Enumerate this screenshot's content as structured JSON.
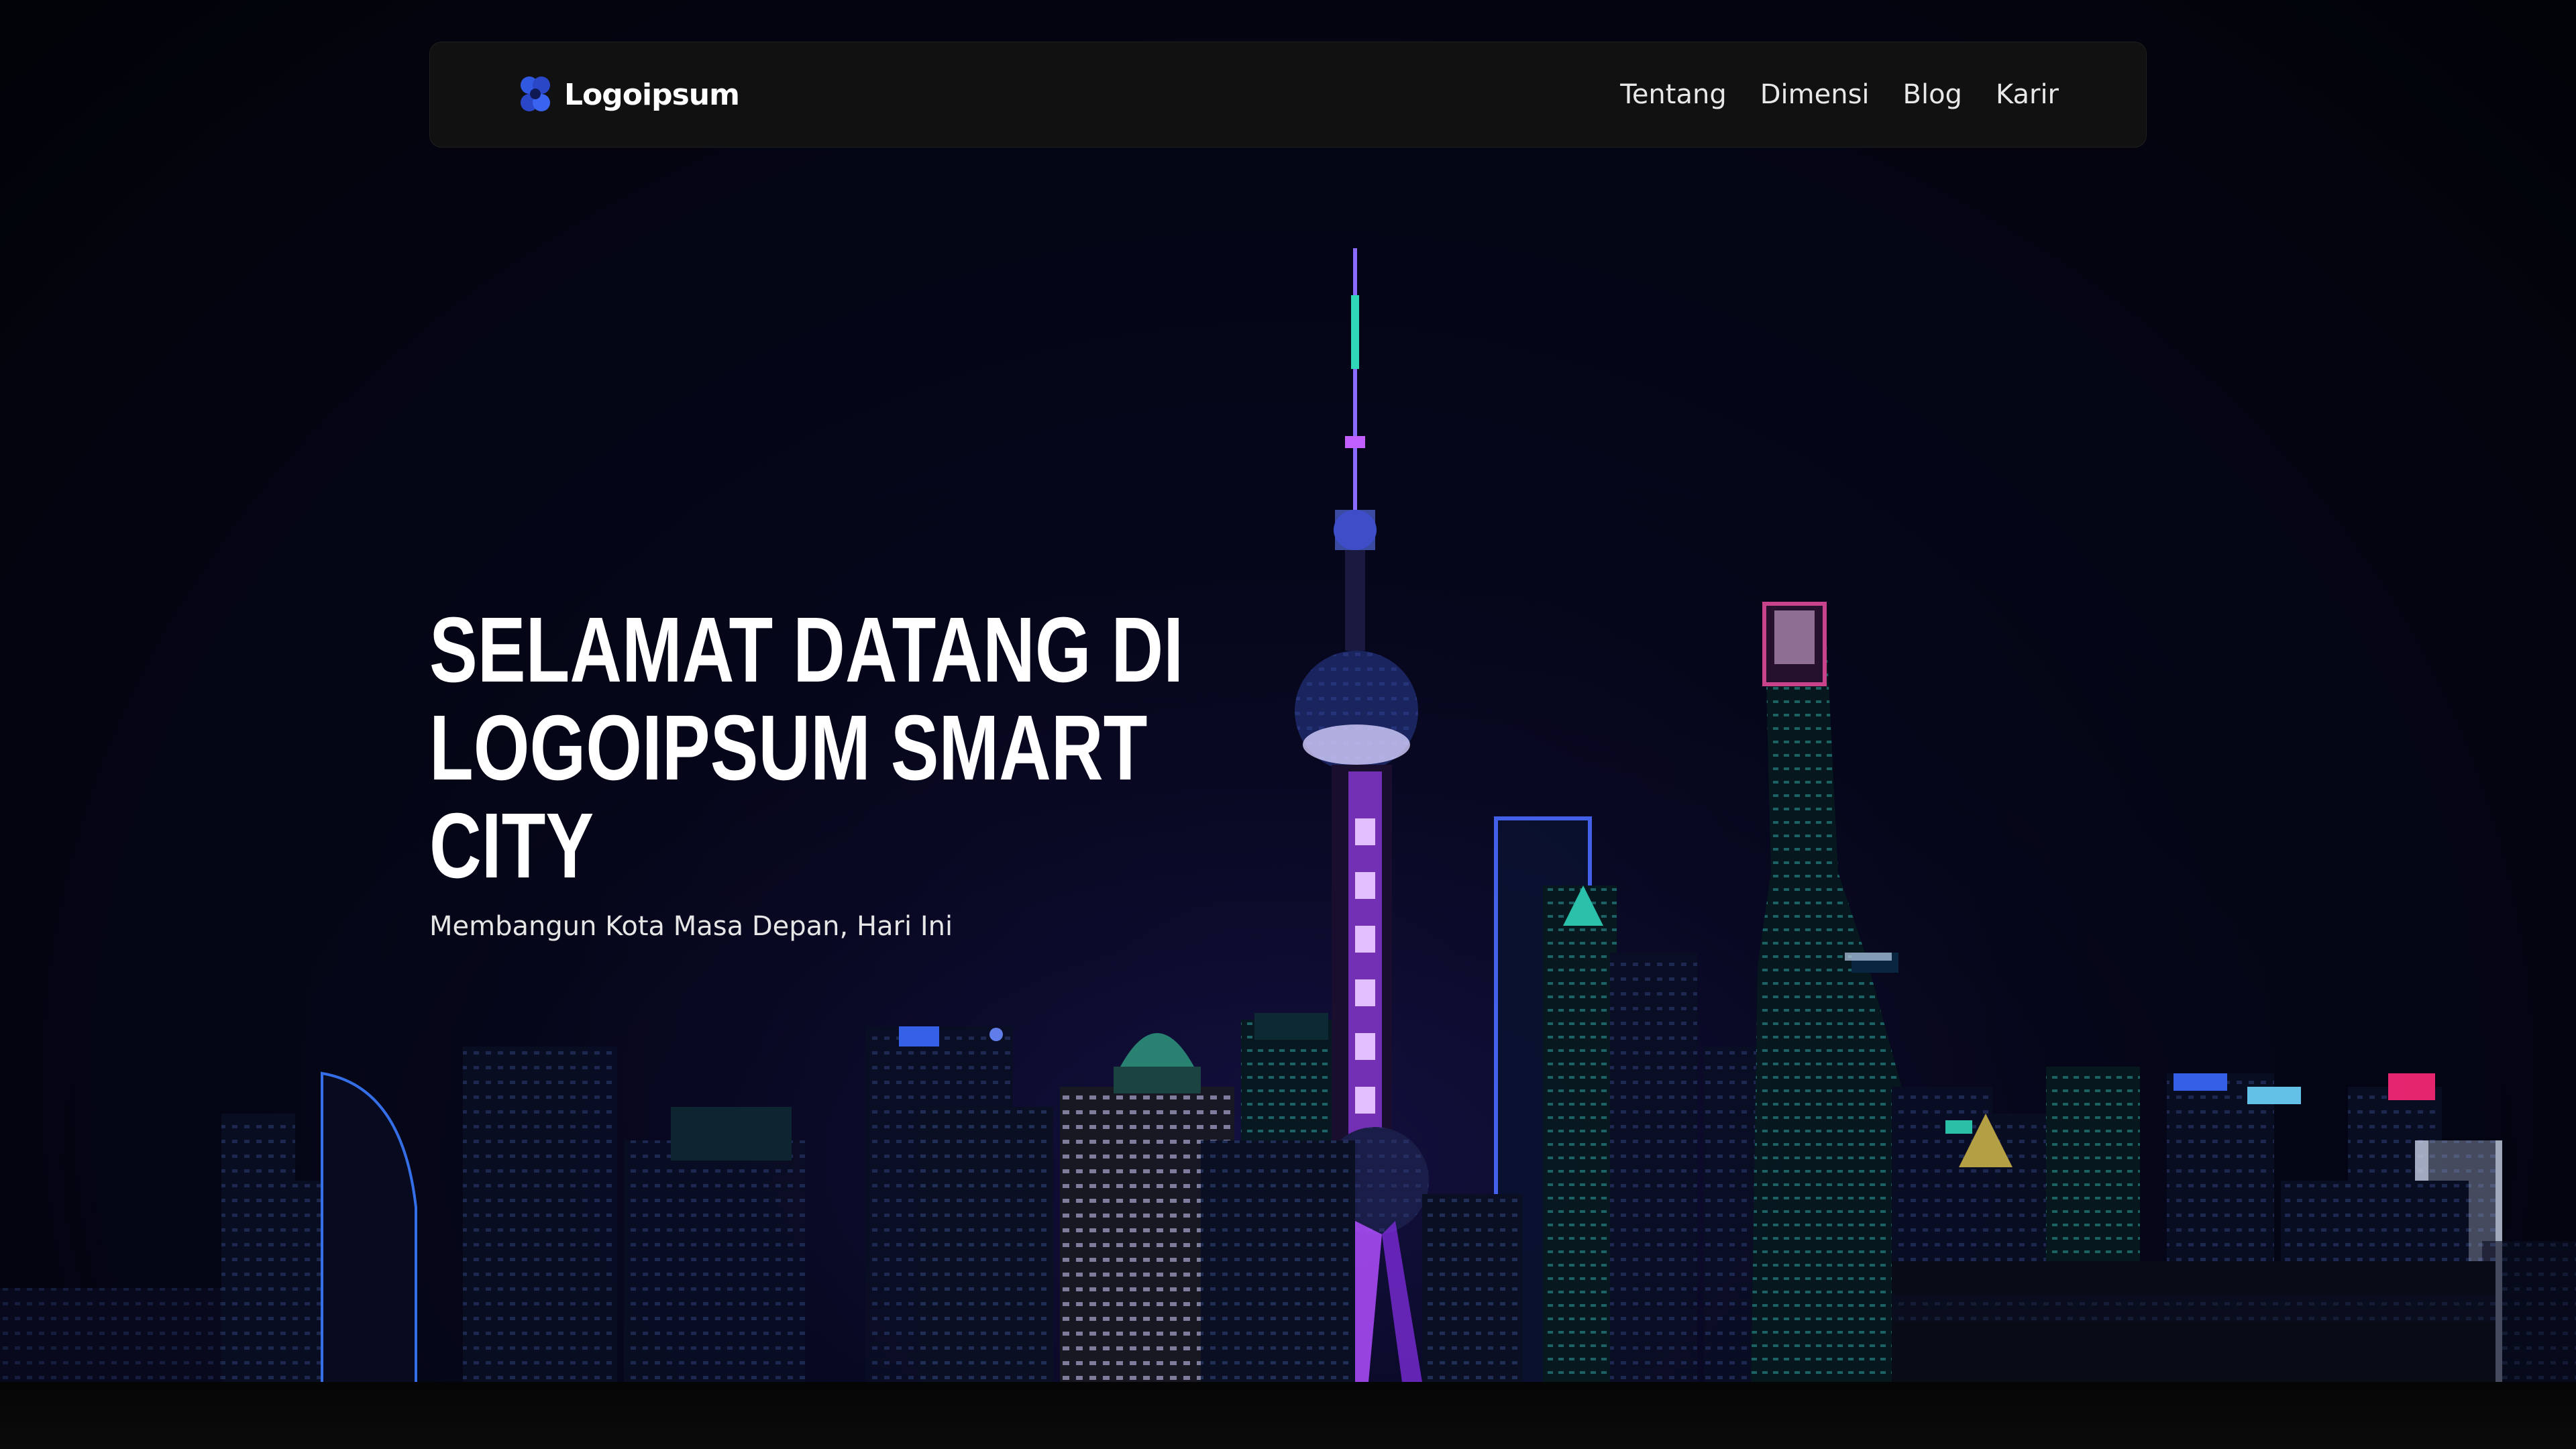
{
  "brand": {
    "name": "Logoipsum",
    "icon": "clover-logo-icon",
    "icon_color": "#2f4fd6"
  },
  "nav": {
    "links": [
      {
        "label": "Tentang"
      },
      {
        "label": "Dimensi"
      },
      {
        "label": "Blog"
      },
      {
        "label": "Karir"
      }
    ]
  },
  "hero": {
    "title_line1": "SELAMAT DATANG DI",
    "title_line2": "LOGOIPSUM SMART CITY",
    "subtitle": "Membangun Kota Masa Depan, Hari Ini"
  },
  "background": {
    "image": "night-city-skyline",
    "colors": {
      "sky": "#03040c",
      "neon_purple": "#b04dff",
      "neon_blue": "#3a5bff",
      "neon_teal": "#2fd6b8",
      "neon_red": "#ff2a5a"
    }
  }
}
